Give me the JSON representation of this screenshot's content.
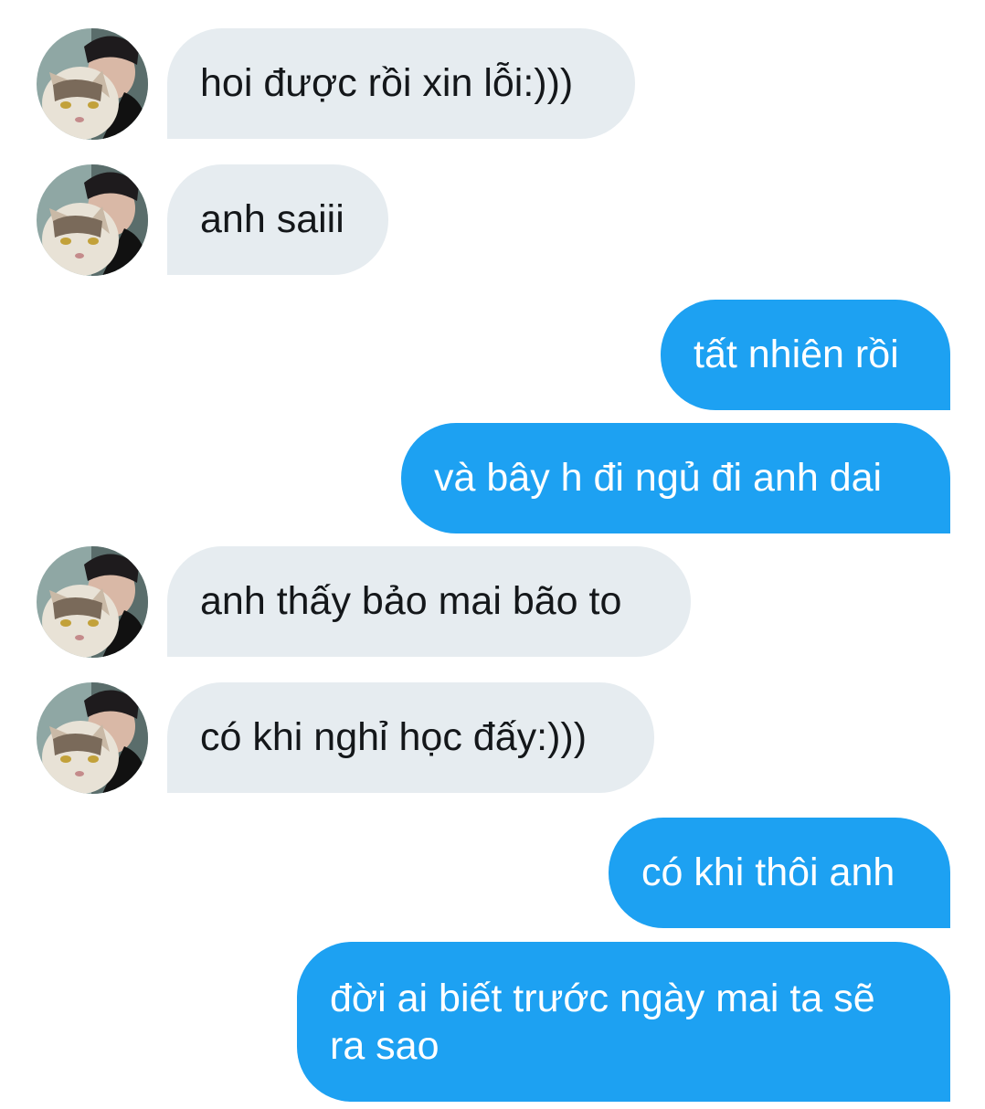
{
  "colors": {
    "incoming_bubble": "#e6ecf0",
    "outgoing_bubble": "#1da1f2",
    "incoming_text": "#14171a",
    "outgoing_text": "#ffffff"
  },
  "messages": [
    {
      "direction": "incoming",
      "text": "hoi được rồi xin lỗi:)))"
    },
    {
      "direction": "incoming",
      "text": "anh saiii"
    },
    {
      "direction": "outgoing",
      "text": "tất nhiên rồi"
    },
    {
      "direction": "outgoing",
      "text": "và bây h đi ngủ đi anh dai"
    },
    {
      "direction": "incoming",
      "text": "anh thấy bảo mai bão to"
    },
    {
      "direction": "incoming",
      "text": "có khi nghỉ học đấy:)))"
    },
    {
      "direction": "outgoing",
      "text": "có khi thôi anh"
    },
    {
      "direction": "outgoing",
      "text": "đời ai biết trước ngày mai ta sẽ ra sao"
    }
  ],
  "avatar_icon": "user-with-cat-photo"
}
